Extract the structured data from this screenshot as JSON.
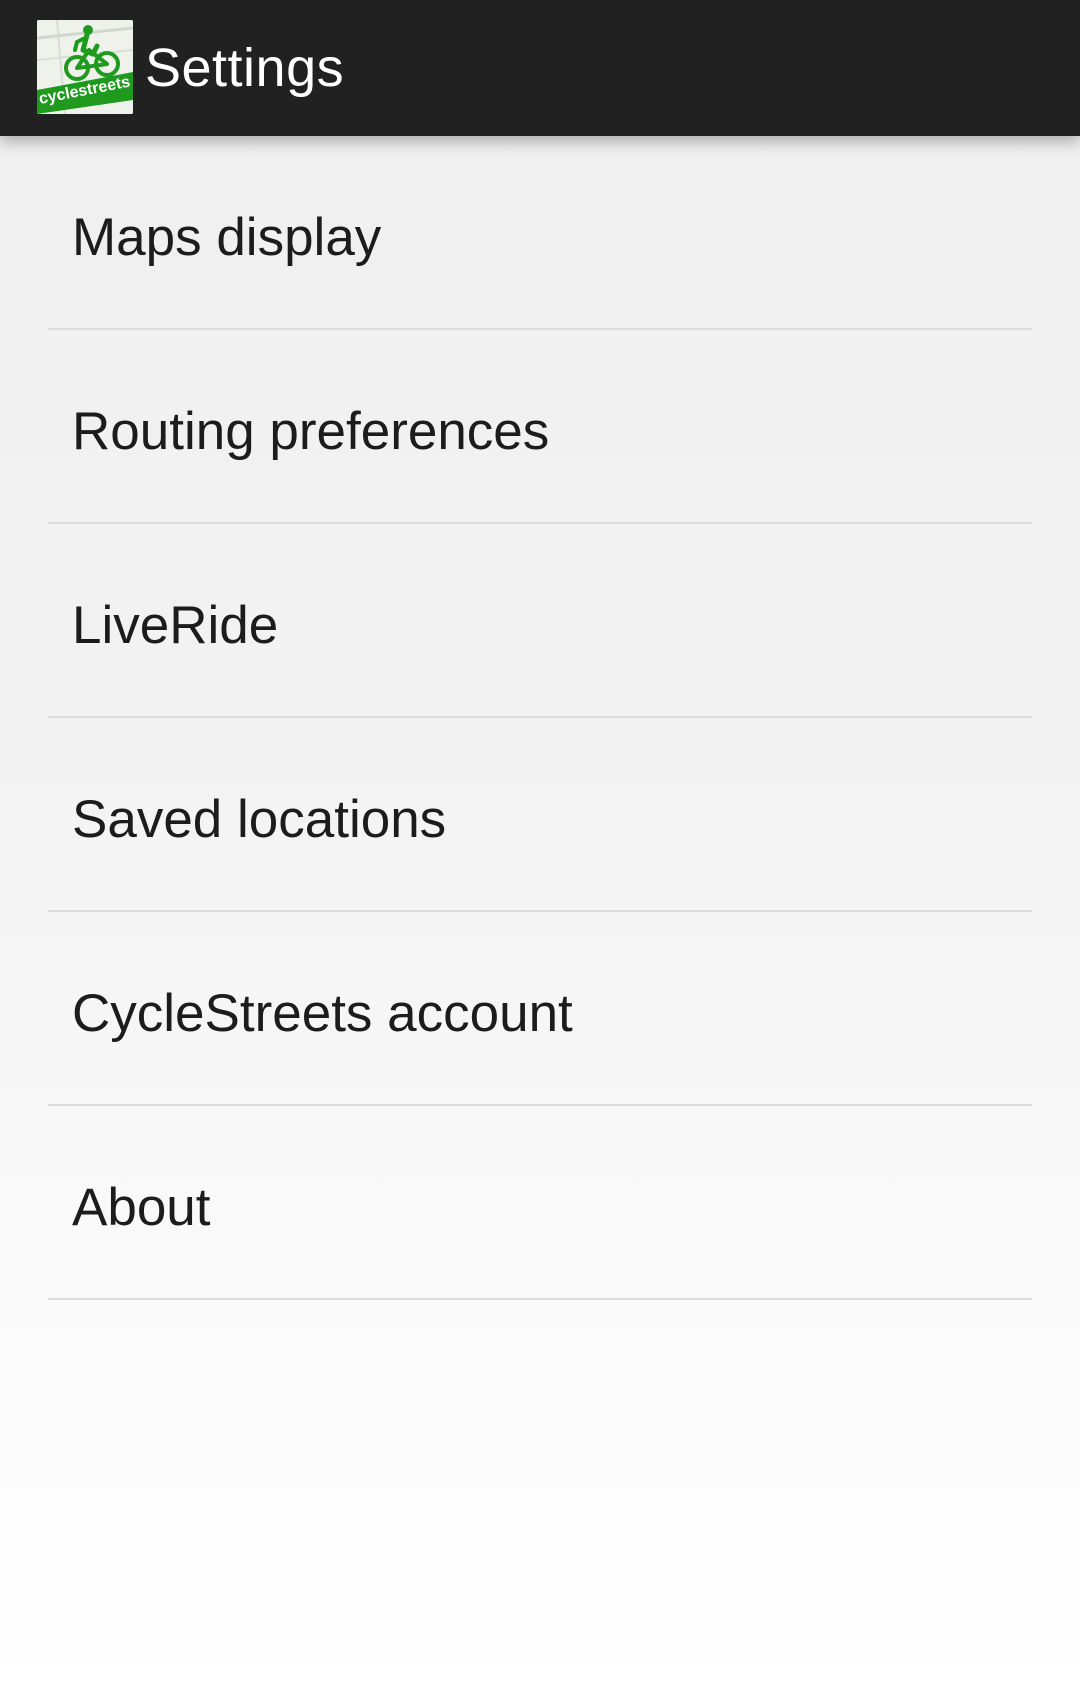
{
  "action_bar": {
    "title": "Settings",
    "logo_icon": "cyclestreets-logo-icon",
    "logo_text": "cyclestreets",
    "background_color": "#212121",
    "brand_color": "#1f9a1f"
  },
  "settings": {
    "items": [
      {
        "label": "Maps display"
      },
      {
        "label": "Routing preferences"
      },
      {
        "label": "LiveRide"
      },
      {
        "label": "Saved locations"
      },
      {
        "label": "CycleStreets account"
      },
      {
        "label": "About"
      }
    ]
  }
}
